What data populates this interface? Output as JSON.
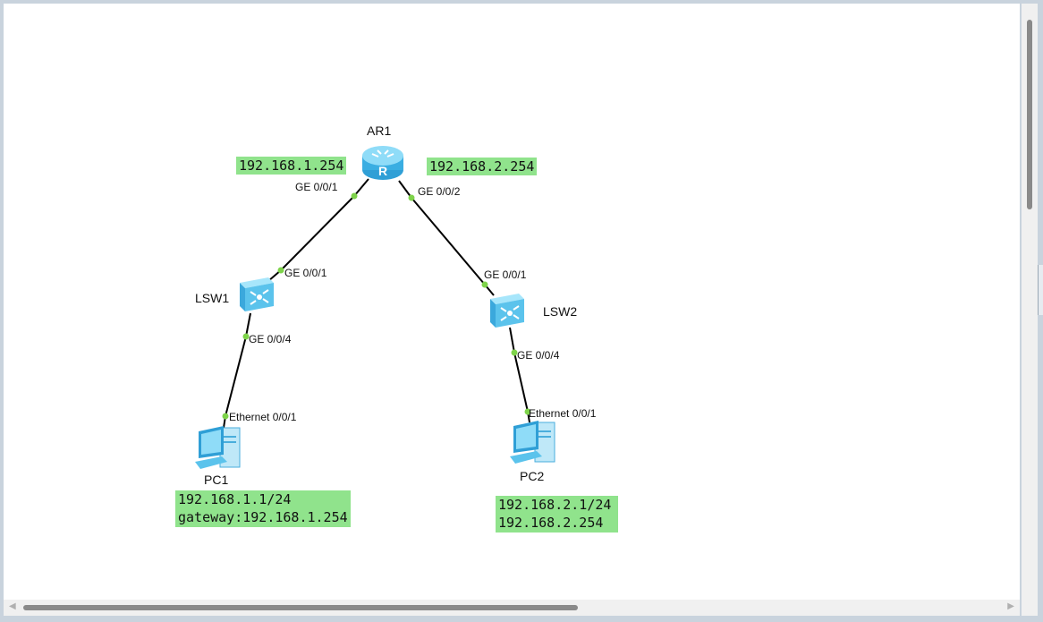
{
  "devices": {
    "router": {
      "name": "AR1",
      "icon": "router-icon"
    },
    "switch1": {
      "name": "LSW1",
      "icon": "switch-icon"
    },
    "switch2": {
      "name": "LSW2",
      "icon": "switch-icon"
    },
    "pc1": {
      "name": "PC1",
      "icon": "pc-icon"
    },
    "pc2": {
      "name": "PC2",
      "icon": "pc-icon"
    }
  },
  "ports": {
    "ar1_left": "GE 0/0/1",
    "ar1_right": "GE 0/0/2",
    "lsw1_up": "GE 0/0/1",
    "lsw1_down": "GE 0/0/4",
    "lsw2_up": "GE 0/0/1",
    "lsw2_down": "GE 0/0/4",
    "pc1_eth": "Ethernet 0/0/1",
    "pc2_eth": "Ethernet 0/0/1"
  },
  "notes": {
    "ar1_left_ip": "192.168.1.254",
    "ar1_right_ip": "192.168.2.254",
    "pc1_line1": "192.168.1.1/24",
    "pc1_line2": "gateway:192.168.1.254",
    "pc2_line1": "192.168.2.1/24",
    "pc2_line2": "192.168.2.254"
  },
  "colors": {
    "note_bg": "#90e38c",
    "port_dot": "#7ed34a",
    "link": "#000000",
    "device_blue": "#5bc3ec"
  }
}
